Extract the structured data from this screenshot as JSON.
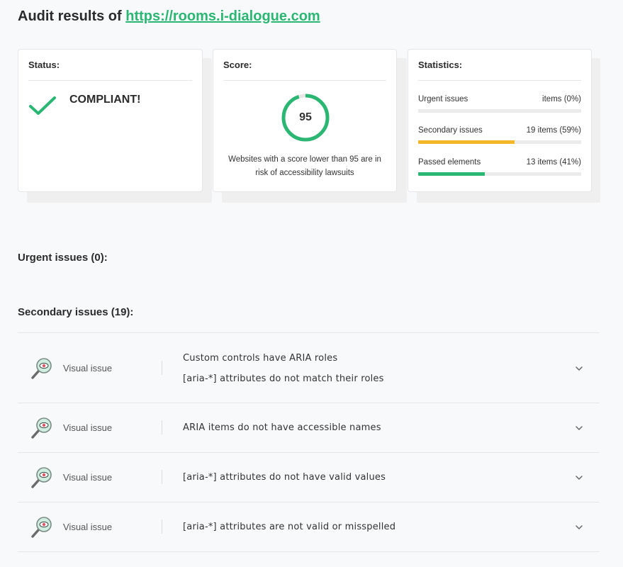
{
  "header": {
    "title_prefix": "Audit results of",
    "site_url": "https://rooms.i-dialogue.com"
  },
  "status_card": {
    "label": "Status:",
    "value": "COMPLIANT!",
    "icon": "checkmark-icon"
  },
  "score_card": {
    "label": "Score:",
    "score": "95",
    "score_percent": 95,
    "description": "Websites with a score lower than 95 are in risk of accessibility lawsuits"
  },
  "stats_card": {
    "label": "Statistics:",
    "items": [
      {
        "label": "Urgent issues",
        "value": "items (0%)",
        "percent": 0,
        "color": "#e74c3c"
      },
      {
        "label": "Secondary issues",
        "value": "19 items (59%)",
        "percent": 59,
        "color": "#f5b72a"
      },
      {
        "label": "Passed elements",
        "value": "13 items (41%)",
        "percent": 41,
        "color": "#2bb673"
      }
    ]
  },
  "sections": {
    "urgent": "Urgent issues (0):",
    "secondary": "Secondary issues (19):"
  },
  "issues": [
    {
      "type": "Visual issue",
      "icon": "magnifier-eye-icon",
      "messages": [
        "Custom controls have ARIA roles",
        "[aria-*] attributes do not match their roles"
      ]
    },
    {
      "type": "Visual issue",
      "icon": "magnifier-eye-icon",
      "messages": [
        "ARIA items do not have accessible names"
      ]
    },
    {
      "type": "Visual issue",
      "icon": "magnifier-eye-icon",
      "messages": [
        "[aria-*] attributes do not have valid values"
      ]
    },
    {
      "type": "Visual issue",
      "icon": "magnifier-eye-icon",
      "messages": [
        "[aria-*] attributes are not valid or misspelled"
      ]
    }
  ],
  "colors": {
    "accent": "#2bb673",
    "warning": "#f5b72a"
  }
}
